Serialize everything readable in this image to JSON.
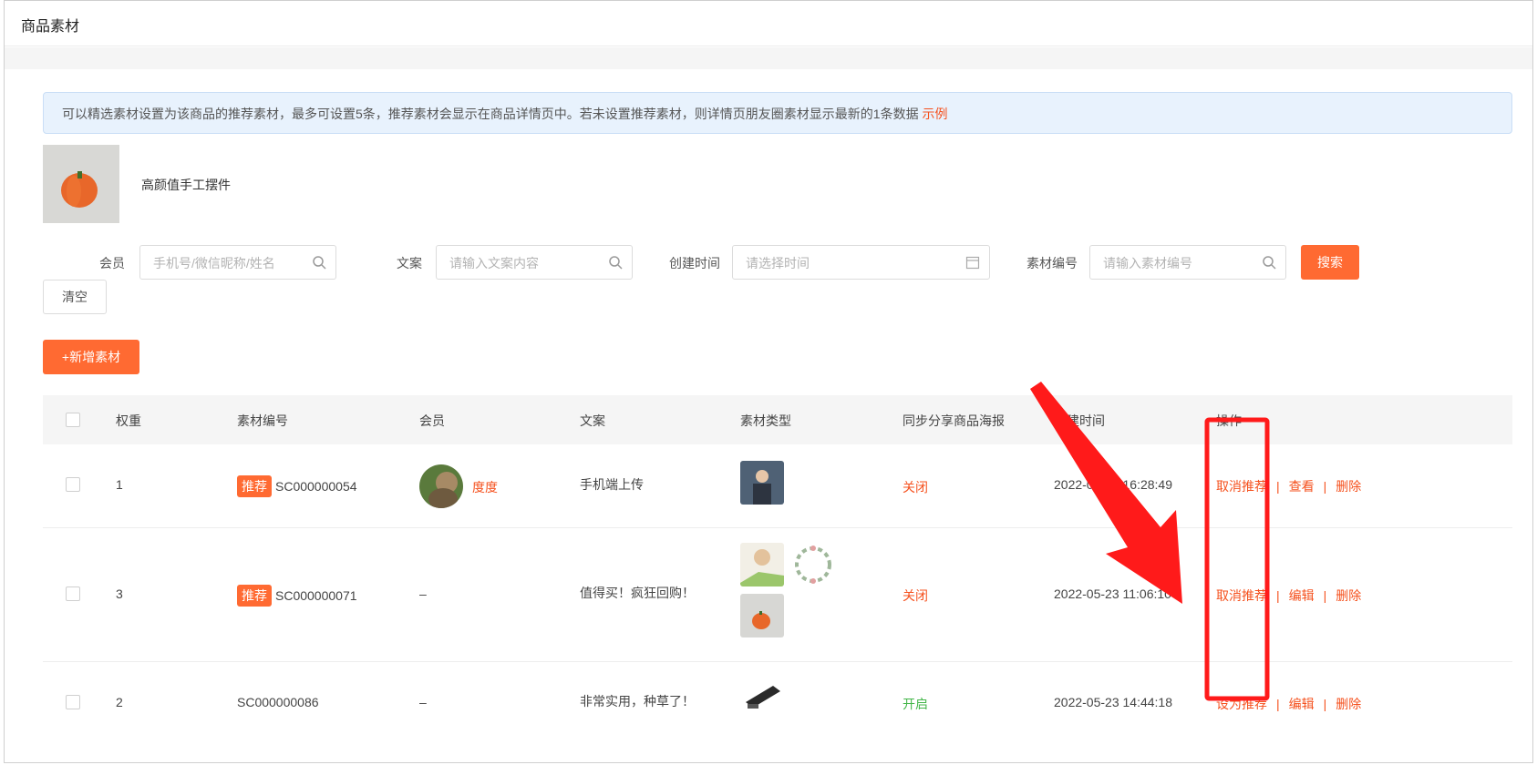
{
  "page": {
    "title": "商品素材"
  },
  "notice": {
    "text": "可以精选素材设置为该商品的推荐素材，最多可设置5条，推荐素材会显示在商品详情页中。若未设置推荐素材，则详情页朋友圈素材显示最新的1条数据",
    "link": "示例"
  },
  "product": {
    "name": "高颜值手工摆件",
    "thumb_icon": "pumpkin-image"
  },
  "filters": {
    "member_label": "会员",
    "member_placeholder": "手机号/微信昵称/姓名",
    "copy_label": "文案",
    "copy_placeholder": "请输入文案内容",
    "time_label": "创建时间",
    "time_placeholder": "请选择时间",
    "code_label": "素材编号",
    "code_placeholder": "请输入素材编号",
    "search": "搜索",
    "clear": "清空"
  },
  "add_button": "+新增素材",
  "table": {
    "headers": [
      "权重",
      "素材编号",
      "会员",
      "文案",
      "素材类型",
      "同步分享商品海报",
      "创建时间",
      "操作"
    ],
    "rows": [
      {
        "weight": "1",
        "recommended": true,
        "badge": "推荐",
        "code": "SC000000054",
        "member": "度度",
        "copy": "手机端上传",
        "poster": "关闭",
        "created": "2022-05-20 16:28:49",
        "ops": [
          "取消推荐",
          "查看",
          "删除"
        ]
      },
      {
        "weight": "3",
        "recommended": true,
        "badge": "推荐",
        "code": "SC000000071",
        "member": "–",
        "copy": "值得买！疯狂回购！",
        "poster": "关闭",
        "created": "2022-05-23 11:06:10",
        "ops": [
          "取消推荐",
          "编辑",
          "删除"
        ]
      },
      {
        "weight": "2",
        "recommended": false,
        "badge": "",
        "code": "SC000000086",
        "member": "–",
        "copy": "非常实用，种草了！",
        "poster": "开启",
        "created": "2022-05-23 14:44:18",
        "ops": [
          "设为推荐",
          "编辑",
          "删除"
        ]
      }
    ]
  },
  "colors": {
    "accent": "#ff6a32",
    "closed": "#f5511e",
    "open": "#43b649",
    "annotation": "#ff1a1a"
  }
}
